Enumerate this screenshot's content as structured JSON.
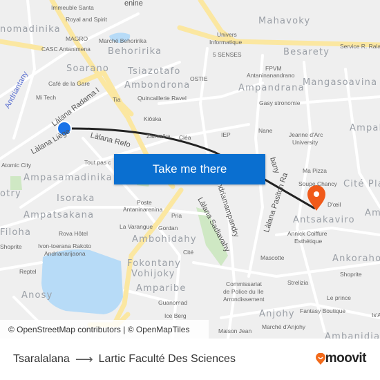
{
  "map": {
    "districts": [
      "nomadinika",
      "Behoririka",
      "Soarano",
      "Tsiazotafo",
      "Ambondrona",
      "Mahavoky",
      "Besarety",
      "Ampandrana",
      "Mangasoavina",
      "Ampah",
      "Ampasamadinika",
      "Isoraka",
      "Ampatsakana",
      "otry",
      "Filoha",
      "Ambohidahy",
      "Fokontany",
      "Vohijoky",
      "Amparibe",
      "Anosy",
      "Antsakaviro",
      "Cité Pla",
      "Ankorahot",
      "Anjohy",
      "Ambanidia",
      "Am"
    ],
    "pois": [
      "Immeuble Santa",
      "Royal and Spirit",
      "MAGRO",
      "Marché Behoririka",
      "CASC Antanimena",
      "Café de la Gare",
      "Mi Tech",
      "Tia",
      "Quincaillerie Ravel",
      "Kiôska",
      "Zaimaika",
      "Cléa",
      "Univers",
      "Informatique",
      "5 SENSES",
      "OSTIE",
      "FPVM",
      "Antaninanandrano",
      "Gasy stronomie",
      "IEP",
      "Nane",
      "Jeanne d'Arc",
      "University",
      "Service R. Rala",
      "Atomic City",
      "Tout pas c",
      "Poste",
      "Antaninarenina",
      "Pria",
      "La Varangue",
      "Gordan",
      "Rova Hôtel",
      "Ivon-toerana Rakoto",
      "Andrianarijaona",
      "Shoprite",
      "Reptel",
      "Cité",
      "Guanomad",
      "Ice Berg",
      "Ma Pizza",
      "Soupe Chancy",
      "D'œil",
      "Annick Coiffure",
      "Esthétique",
      "Mascotte",
      "Shoprite",
      "Strelizia",
      "Commissariat",
      "de Police du IIe",
      "Arrondissement",
      "Le prince",
      "Fantasy Boutique",
      "Marché d'Anjohy",
      "Maison Jean",
      "Is'A"
    ],
    "streets": [
      "Làlana Radama I",
      "Làlana Liège",
      "Làlana Refo",
      "Andriantany",
      "Làlana Sadiavahy",
      "Andriamampandry",
      "Làlana Pasiton Ra",
      "bany",
      "enine"
    ],
    "route_color": "#222222",
    "origin_color": "#1a73e8",
    "destination_color": "#f05a1a",
    "origin_icon": "blue-dot-icon",
    "destination_icon": "map-pin-icon"
  },
  "cta": {
    "label": "Take me there",
    "color": "#0a6fd0"
  },
  "attribution": "© OpenStreetMap contributors | © OpenMapTiles",
  "footer": {
    "from": "Tsaralalana",
    "arrow_icon": "arrow-right-icon",
    "to": "Lartic Faculté Des Sciences",
    "logo": "moovit",
    "brand_color": "#f26a1b"
  }
}
